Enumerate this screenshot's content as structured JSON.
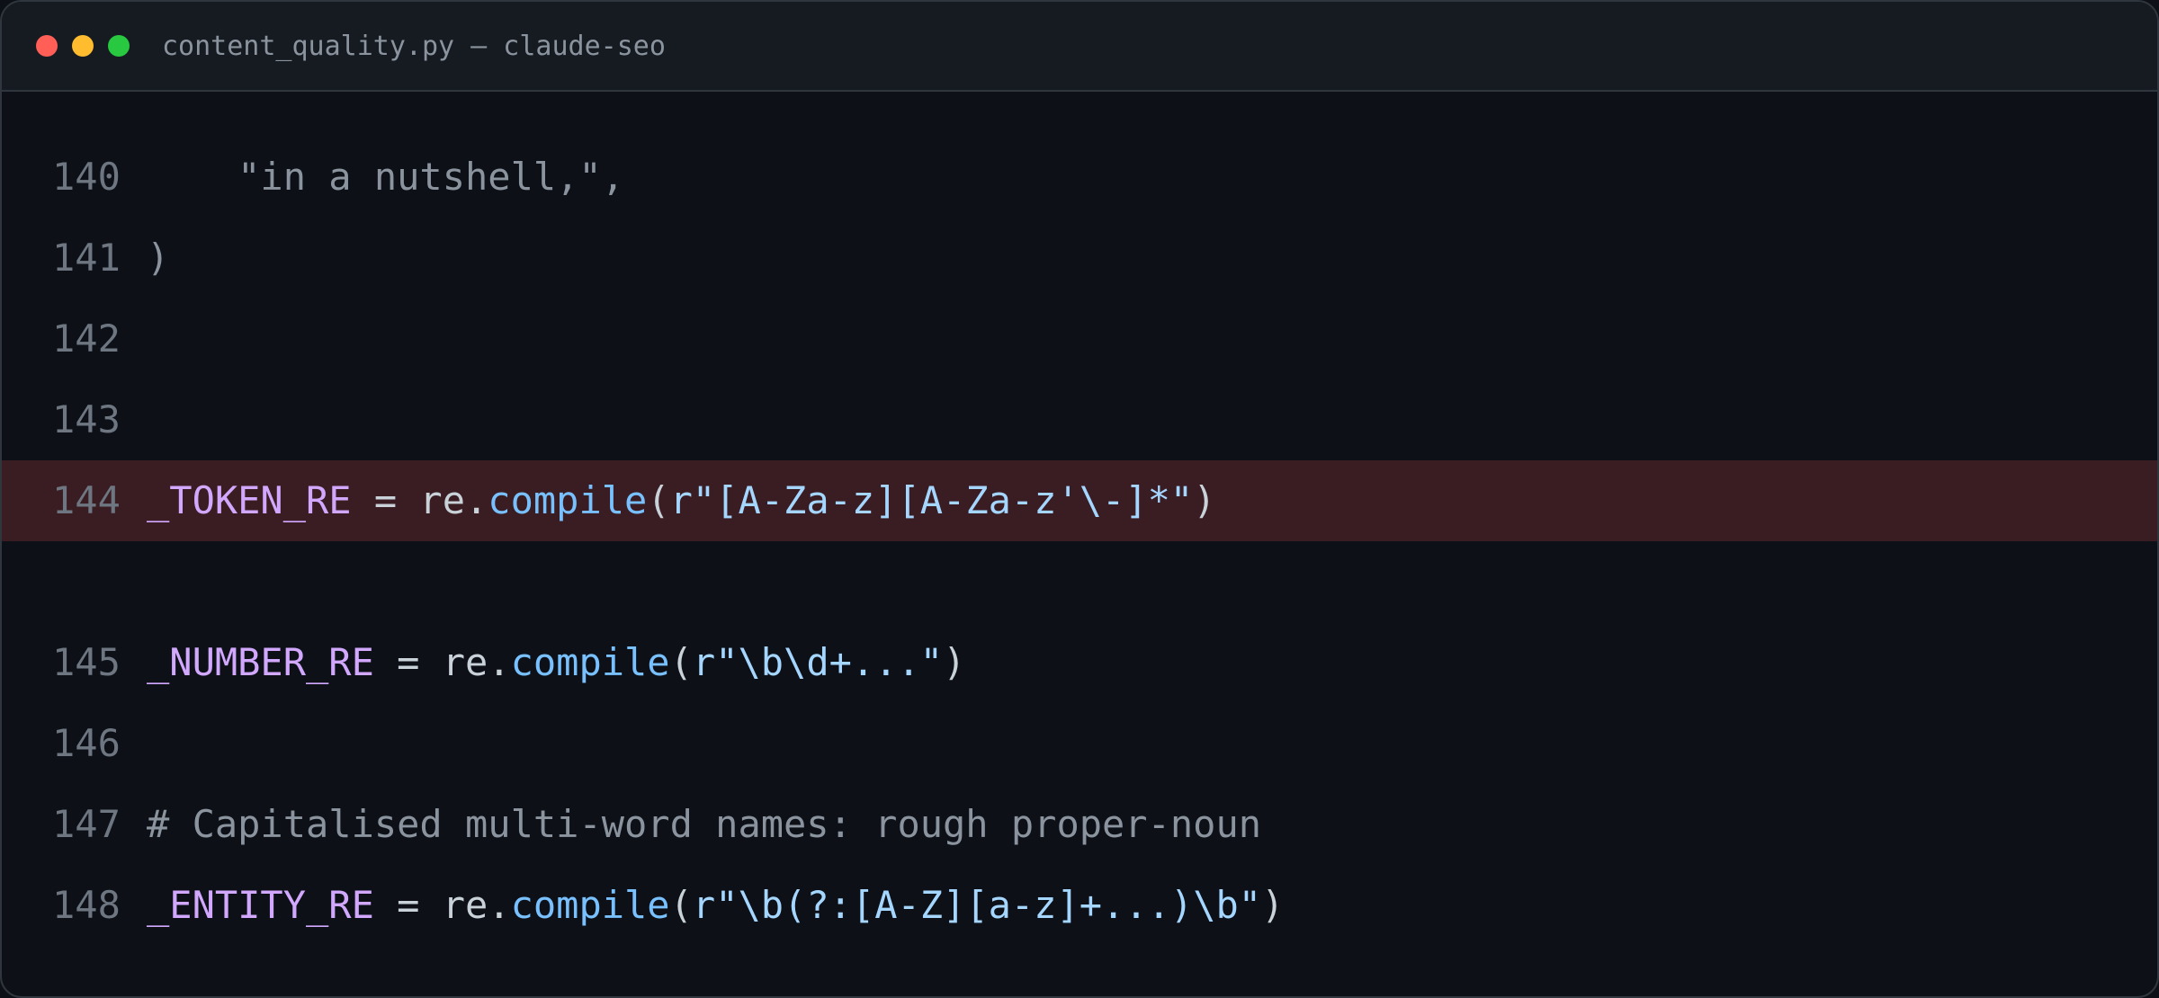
{
  "window": {
    "title": "content_quality.py — claude-seo"
  },
  "lines": [
    {
      "number": "140",
      "text": "    \"in a nutshell,\","
    },
    {
      "number": "141",
      "text": ")"
    },
    {
      "number": "142",
      "text": ""
    },
    {
      "number": "143",
      "text": ""
    },
    {
      "number": "144",
      "var": "_TOKEN_RE",
      "eq": " = re.",
      "fn": "compile",
      "open": "(",
      "str": "r\"[A-Za-z][A-Za-z'\\-]*\"",
      "close": ")"
    },
    {
      "number": "145",
      "var": "_NUMBER_RE",
      "eq": " = re.",
      "fn": "compile",
      "open": "(",
      "str": "r\"\\b\\d+...\"",
      "close": ")"
    },
    {
      "number": "146",
      "text": ""
    },
    {
      "number": "147",
      "text": "# Capitalised multi-word names: rough proper-noun"
    },
    {
      "number": "148",
      "var": "_ENTITY_RE",
      "eq": " = re.",
      "fn": "compile",
      "open": "(",
      "str": "r\"\\b(?:[A-Z][a-z]+...)\\b\"",
      "close": ")"
    }
  ],
  "highlight": {
    "line": "144",
    "color": "#3a1d22"
  },
  "colors": {
    "background": "#0d1117",
    "titlebar": "#161b22",
    "variable": "#d2a8ff",
    "function": "#79c0ff",
    "string": "#a5d6ff",
    "comment": "#8b949e",
    "line_number": "#6e7681"
  }
}
